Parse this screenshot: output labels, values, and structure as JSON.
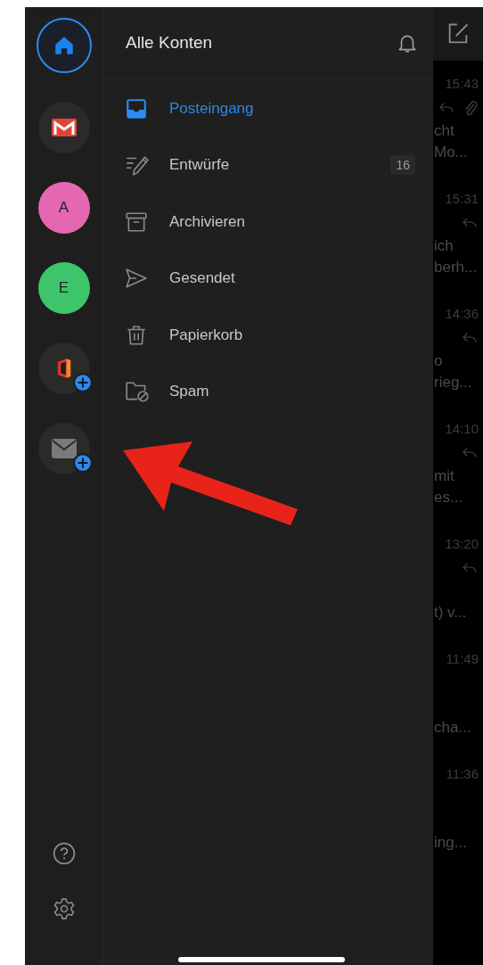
{
  "accounts": [
    {
      "kind": "home",
      "selected": true,
      "add": false
    },
    {
      "kind": "gmail",
      "selected": false,
      "add": false
    },
    {
      "kind": "avatar",
      "letter": "A",
      "color": "#e667b1",
      "selected": false,
      "add": false
    },
    {
      "kind": "avatar",
      "letter": "E",
      "color": "#3ec56b",
      "selected": false,
      "add": false
    },
    {
      "kind": "office",
      "selected": false,
      "add": true
    },
    {
      "kind": "mail",
      "selected": false,
      "add": true
    }
  ],
  "rail_bottom": [
    {
      "kind": "help"
    },
    {
      "kind": "settings"
    }
  ],
  "folder_pane": {
    "title": "Alle Konten",
    "folders": [
      {
        "kind": "inbox",
        "label": "Posteingang",
        "selected": true
      },
      {
        "kind": "drafts",
        "label": "Entwürfe",
        "count": "16",
        "selected": false
      },
      {
        "kind": "archive",
        "label": "Archivieren",
        "selected": false
      },
      {
        "kind": "sent",
        "label": "Gesendet",
        "selected": false
      },
      {
        "kind": "trash",
        "label": "Papierkorb",
        "selected": false
      },
      {
        "kind": "spam",
        "label": "Spam",
        "selected": false
      }
    ]
  },
  "message_list": [
    {
      "time": "15:43",
      "reply": true,
      "attachment": true,
      "line_1": "cht",
      "line_2": "Mo..."
    },
    {
      "time": "15:31",
      "reply": true,
      "attachment": false,
      "line_1": "ich",
      "line_2": "berh..."
    },
    {
      "time": "14:36",
      "reply": true,
      "attachment": false,
      "line_1": "o",
      "line_2": "rieg..."
    },
    {
      "time": "14:10",
      "reply": true,
      "attachment": false,
      "line_1": "mit",
      "line_2": "es..."
    },
    {
      "time": "13:20",
      "reply": true,
      "attachment": false,
      "line_2": "t) v..."
    },
    {
      "time": "11:49",
      "reply": false,
      "attachment": false,
      "line_2": "cha..."
    },
    {
      "time": "11:36",
      "reply": false,
      "attachment": false,
      "line_2": "ing..."
    }
  ]
}
